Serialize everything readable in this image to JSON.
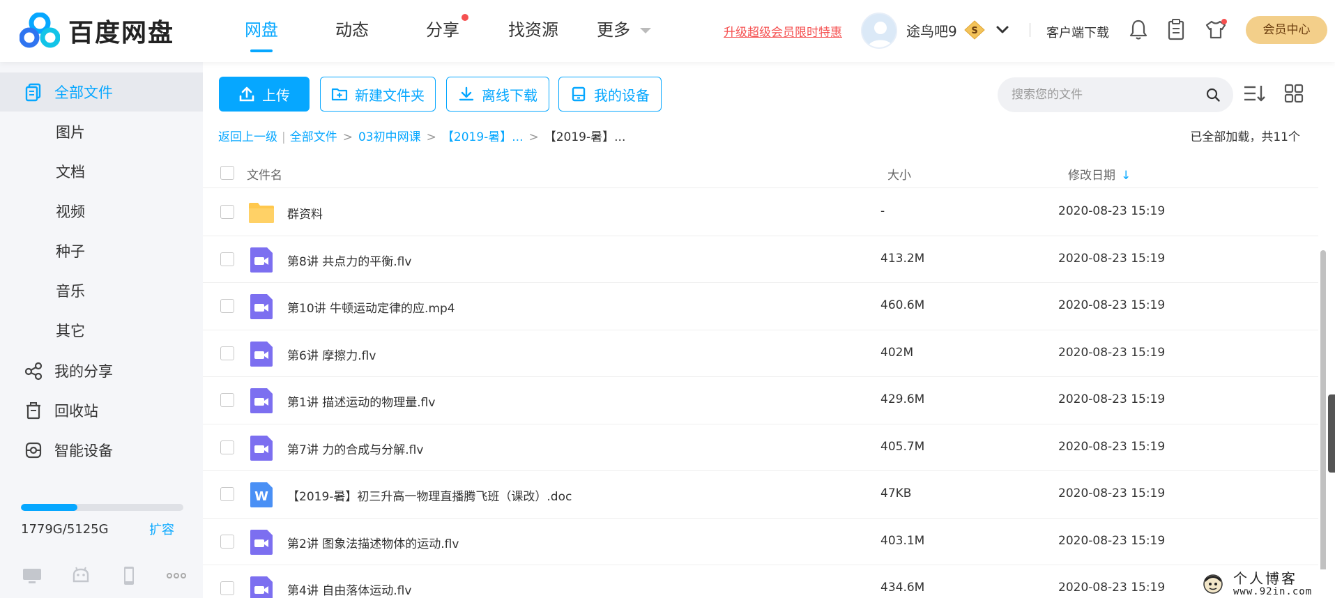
{
  "header": {
    "brand": "百度网盘",
    "nav": [
      {
        "label": "网盘",
        "active": true
      },
      {
        "label": "动态"
      },
      {
        "label": "分享",
        "dot": true
      },
      {
        "label": "找资源"
      },
      {
        "label": "更多"
      }
    ],
    "promo_text": "升级超级会员限时特惠",
    "username": "途鸟吧9",
    "vip_badge": "S",
    "client_download": "客户端下载",
    "vip_center": "会员中心",
    "icons": [
      "bell-icon",
      "clipboard-icon",
      "tshirt-icon"
    ]
  },
  "sidebar": {
    "items": [
      {
        "label": "全部文件",
        "icon": "all-files-icon",
        "active": true
      },
      {
        "label": "图片"
      },
      {
        "label": "文档"
      },
      {
        "label": "视频"
      },
      {
        "label": "种子"
      },
      {
        "label": "音乐"
      },
      {
        "label": "其它"
      },
      {
        "label": "我的分享",
        "icon": "share-icon"
      },
      {
        "label": "回收站",
        "icon": "trash-icon"
      },
      {
        "label": "智能设备",
        "icon": "smart-device-icon"
      }
    ],
    "storage": {
      "used_text": "1779G/5125G",
      "used": 1779,
      "total": 5125,
      "expand_label": "扩容"
    },
    "device_icons": [
      "desktop-icon",
      "android-icon",
      "phone-icon",
      "more-icon"
    ]
  },
  "toolbar": {
    "upload": "上传",
    "new_folder": "新建文件夹",
    "offline_download": "离线下载",
    "my_devices": "我的设备",
    "search_placeholder": "搜索您的文件"
  },
  "breadcrumb": {
    "back": "返回上一级",
    "items": [
      "全部文件",
      "03初中网课",
      "【2019-暑】..."
    ],
    "current": "【2019-暑】...",
    "loaded_text": "已全部加载，共11个"
  },
  "table": {
    "headers": {
      "name": "文件名",
      "size": "大小",
      "date": "修改日期"
    },
    "rows": [
      {
        "type": "folder",
        "name": "群资料",
        "size": "-",
        "date": "2020-08-23 15:19"
      },
      {
        "type": "video",
        "name": "第8讲 共点力的平衡.flv",
        "size": "413.2M",
        "date": "2020-08-23 15:19"
      },
      {
        "type": "video",
        "name": "第10讲 牛顿运动定律的应.mp4",
        "size": "460.6M",
        "date": "2020-08-23 15:19"
      },
      {
        "type": "video",
        "name": "第6讲 摩擦力.flv",
        "size": "402M",
        "date": "2020-08-23 15:19"
      },
      {
        "type": "video",
        "name": "第1讲 描述运动的物理量.flv",
        "size": "429.6M",
        "date": "2020-08-23 15:19"
      },
      {
        "type": "video",
        "name": "第7讲 力的合成与分解.flv",
        "size": "405.7M",
        "date": "2020-08-23 15:19"
      },
      {
        "type": "doc",
        "name": "【2019-暑】初三升高一物理直播腾飞班（课改）.doc",
        "size": "47KB",
        "date": "2020-08-23 15:19"
      },
      {
        "type": "video",
        "name": "第2讲 图象法描述物体的运动.flv",
        "size": "403.1M",
        "date": "2020-08-23 15:19"
      },
      {
        "type": "video",
        "name": "第4讲 自由落体运动.flv",
        "size": "434.6M",
        "date": "2020-08-23 15:19"
      }
    ]
  },
  "watermark": {
    "title": "个人博客",
    "url": "www.92in.com"
  },
  "colors": {
    "accent": "#06a7ff",
    "promo": "#f55050",
    "vip_gold": "#f3cf8a",
    "video_icon": "#7c6ff0",
    "folder": "#ffc84d",
    "doc_icon": "#4a90f5"
  }
}
